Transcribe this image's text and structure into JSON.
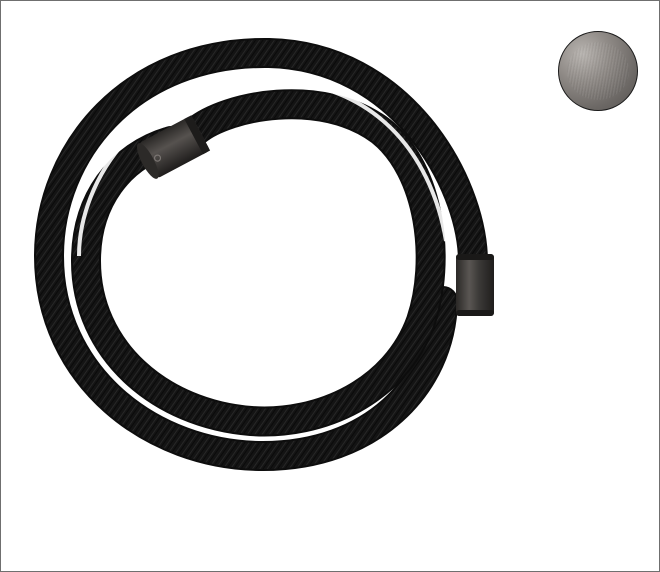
{
  "image": {
    "subject": "hose-icon",
    "colors": {
      "hose": "#151515",
      "background": "#ffffff",
      "frame_border": "#6f6f6f",
      "connector_metal": "#3a3836",
      "swatch_finish": "#8a8580"
    }
  },
  "finish_swatch": {
    "icon": "color-swatch-icon",
    "color": "#8a8580"
  }
}
